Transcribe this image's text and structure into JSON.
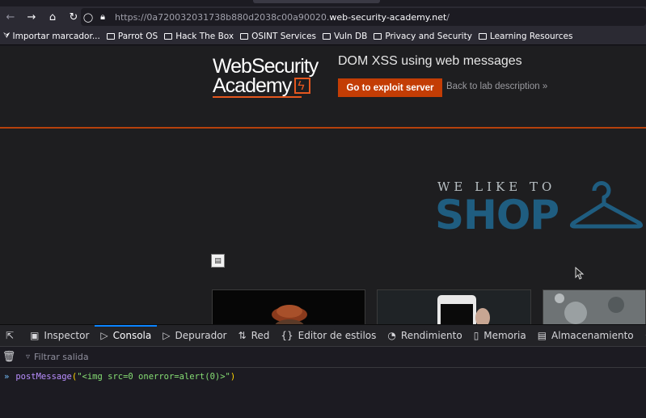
{
  "browser": {
    "url_prefix": "https://0a720032031738b880d2038c00a90020.",
    "url_domain": "web-security-academy.net",
    "url_suffix": "/",
    "bookmarks": [
      {
        "label": "Importar marcador...",
        "icon": "import-icon"
      },
      {
        "label": "Parrot OS",
        "icon": "folder-icon"
      },
      {
        "label": "Hack The Box",
        "icon": "folder-icon"
      },
      {
        "label": "OSINT Services",
        "icon": "folder-icon"
      },
      {
        "label": "Vuln DB",
        "icon": "folder-icon"
      },
      {
        "label": "Privacy and Security",
        "icon": "folder-icon"
      },
      {
        "label": "Learning Resources",
        "icon": "folder-icon"
      }
    ]
  },
  "lab": {
    "logo_line1": "WebSecurity",
    "logo_line2": "Academy",
    "title": "DOM XSS using web messages",
    "exploit_button": "Go to exploit server",
    "back_link": "Back to lab description",
    "back_chevron": "»",
    "accent_color": "#c33d05"
  },
  "shop": {
    "tagline": "WE LIKE TO",
    "word": "SHOP"
  },
  "devtools": {
    "tabs": [
      {
        "label": "",
        "icon": "pick-element-icon"
      },
      {
        "label": "Inspector",
        "icon": "inspector-icon"
      },
      {
        "label": "Consola",
        "icon": "console-icon",
        "selected": true
      },
      {
        "label": "Depurador",
        "icon": "debugger-icon"
      },
      {
        "label": "Red",
        "icon": "network-icon"
      },
      {
        "label": "Editor de estilos",
        "icon": "style-editor-icon"
      },
      {
        "label": "Rendimiento",
        "icon": "performance-icon"
      },
      {
        "label": "Memoria",
        "icon": "memory-icon"
      },
      {
        "label": "Almacenamiento",
        "icon": "storage-icon"
      },
      {
        "label": "",
        "icon": "accessibility-icon"
      }
    ],
    "filter_placeholder": "Filtrar salida",
    "console_input": {
      "function": "postMessage",
      "open": "(",
      "argument": "\"<img src=0 onerror=alert(0)>\"",
      "close": ")"
    }
  }
}
